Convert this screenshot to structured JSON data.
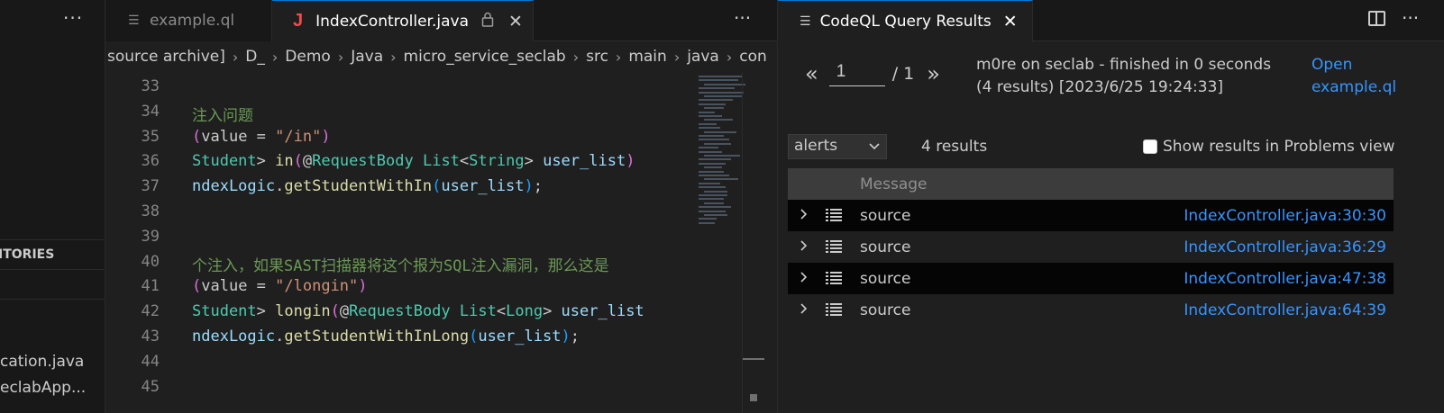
{
  "sidebar": {
    "more": "···",
    "section_title": "ITORIES",
    "files": [
      "cation.java",
      "eclabApp..."
    ]
  },
  "editor": {
    "tabs": [
      {
        "label": "example.ql",
        "active": false
      },
      {
        "label": "IndexController.java",
        "active": true,
        "icon": "J",
        "locked": true,
        "close": "✕"
      }
    ],
    "more": "···",
    "breadcrumb": [
      "source archive]",
      "D_",
      "Demo",
      "Java",
      "micro_service_seclab",
      "src",
      "main",
      "java",
      "con"
    ],
    "lines": [
      {
        "n": "33",
        "tokens": []
      },
      {
        "n": "34",
        "tokens": [
          {
            "t": "注入问题",
            "c": "c-cm"
          }
        ]
      },
      {
        "n": "35",
        "tokens": [
          {
            "t": "(",
            "c": "c-par"
          },
          {
            "t": "value = ",
            "c": "c-pl"
          },
          {
            "t": "\"/in\"",
            "c": "c-str"
          },
          {
            "t": ")",
            "c": "c-par"
          }
        ]
      },
      {
        "n": "36",
        "tokens": [
          {
            "t": "Student",
            "c": "c-ty"
          },
          {
            "t": "> ",
            "c": "c-pl"
          },
          {
            "t": "in",
            "c": "c-fn"
          },
          {
            "t": "(",
            "c": "c-par"
          },
          {
            "t": "@",
            "c": "c-pl"
          },
          {
            "t": "RequestBody",
            "c": "c-ty"
          },
          {
            "t": " ",
            "c": "c-pl"
          },
          {
            "t": "List",
            "c": "c-ty"
          },
          {
            "t": "<",
            "c": "c-pl"
          },
          {
            "t": "String",
            "c": "c-ty"
          },
          {
            "t": "> ",
            "c": "c-pl"
          },
          {
            "t": "user_list",
            "c": "c-var"
          },
          {
            "t": ")",
            "c": "c-par"
          }
        ]
      },
      {
        "n": "37",
        "tokens": [
          {
            "t": "ndexLogic",
            "c": "c-var"
          },
          {
            "t": ".",
            "c": "c-pl"
          },
          {
            "t": "getStudentWithIn",
            "c": "c-fn"
          },
          {
            "t": "(",
            "c": "c-br"
          },
          {
            "t": "user_list",
            "c": "c-var"
          },
          {
            "t": ")",
            "c": "c-br"
          },
          {
            "t": ";",
            "c": "c-pl"
          }
        ]
      },
      {
        "n": "38",
        "tokens": []
      },
      {
        "n": "39",
        "tokens": []
      },
      {
        "n": "40",
        "tokens": [
          {
            "t": "个注入，如果SAST扫描器将这个报为SQL注入漏洞，那么这是",
            "c": "c-cm"
          }
        ]
      },
      {
        "n": "41",
        "tokens": [
          {
            "t": "(",
            "c": "c-par"
          },
          {
            "t": "value = ",
            "c": "c-pl"
          },
          {
            "t": "\"/longin\"",
            "c": "c-str"
          },
          {
            "t": ")",
            "c": "c-par"
          }
        ]
      },
      {
        "n": "42",
        "tokens": [
          {
            "t": "Student",
            "c": "c-ty"
          },
          {
            "t": "> ",
            "c": "c-pl"
          },
          {
            "t": "longin",
            "c": "c-fn"
          },
          {
            "t": "(",
            "c": "c-par"
          },
          {
            "t": "@",
            "c": "c-pl"
          },
          {
            "t": "RequestBody",
            "c": "c-ty"
          },
          {
            "t": " ",
            "c": "c-pl"
          },
          {
            "t": "List",
            "c": "c-ty"
          },
          {
            "t": "<",
            "c": "c-pl"
          },
          {
            "t": "Long",
            "c": "c-ty"
          },
          {
            "t": "> ",
            "c": "c-pl"
          },
          {
            "t": "user_list",
            "c": "c-var"
          }
        ]
      },
      {
        "n": "43",
        "tokens": [
          {
            "t": "ndexLogic",
            "c": "c-var"
          },
          {
            "t": ".",
            "c": "c-pl"
          },
          {
            "t": "getStudentWithInLong",
            "c": "c-fn"
          },
          {
            "t": "(",
            "c": "c-br"
          },
          {
            "t": "user_list",
            "c": "c-var"
          },
          {
            "t": ")",
            "c": "c-br"
          },
          {
            "t": ";",
            "c": "c-pl"
          }
        ]
      },
      {
        "n": "44",
        "tokens": []
      },
      {
        "n": "45",
        "tokens": []
      }
    ]
  },
  "results": {
    "tab_title": "CodeQL Query Results",
    "tab_close": "✕",
    "more": "···",
    "pager": {
      "prev": "«",
      "page": "1",
      "total": "/ 1",
      "next": "»"
    },
    "status_line1": "m0re on seclab - finished in 0 seconds",
    "status_line2": "(4 results) [2023/6/25 19:24:33]",
    "open_line1": "Open",
    "open_line2": "example.ql",
    "filter": "alerts",
    "count": "4 results",
    "problems_label": "Show results in Problems view",
    "column_header": "Message",
    "rows": [
      {
        "message": "source",
        "location": "IndexController.java:30:30"
      },
      {
        "message": "source",
        "location": "IndexController.java:36:29"
      },
      {
        "message": "source",
        "location": "IndexController.java:47:38"
      },
      {
        "message": "source",
        "location": "IndexController.java:64:39"
      }
    ]
  }
}
